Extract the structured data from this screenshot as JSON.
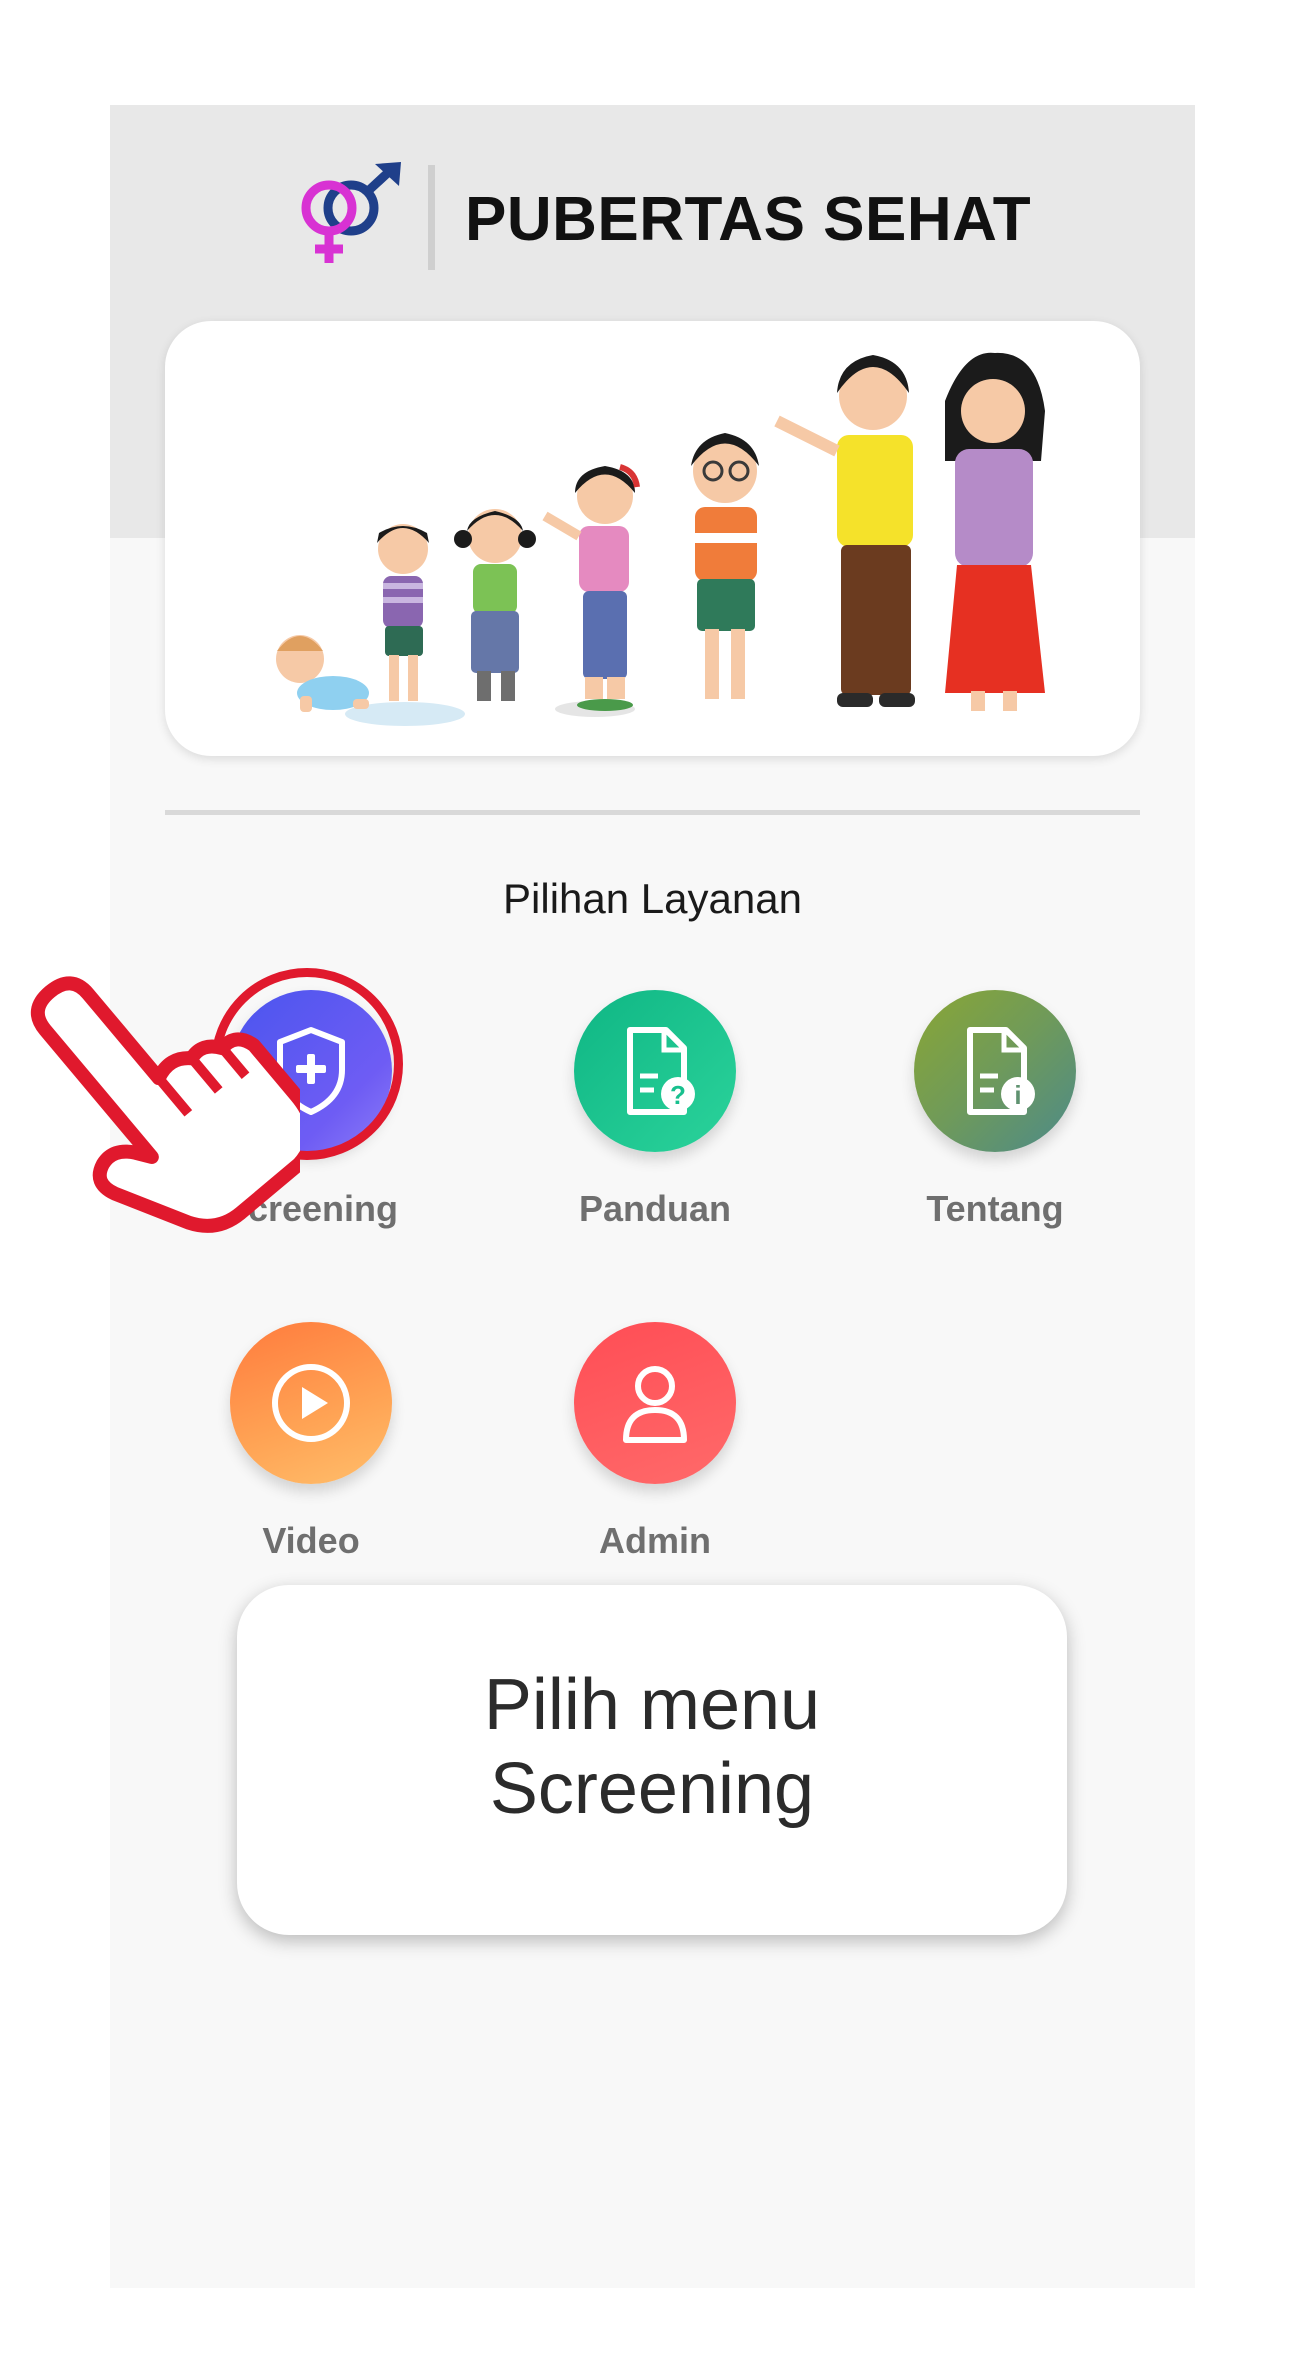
{
  "header": {
    "title": "PUBERTAS SEHAT",
    "logo_icon": "gender-symbols-icon"
  },
  "banner": {
    "image": "growth-stages-illustration"
  },
  "section": {
    "title": "Pilihan Layanan"
  },
  "menu": [
    {
      "id": "screening",
      "label": "Screening",
      "icon": "shield-plus-icon",
      "colors": [
        "#4a55ee",
        "#8c7cf7"
      ]
    },
    {
      "id": "panduan",
      "label": "Panduan",
      "icon": "document-question-icon",
      "colors": [
        "#0fb684",
        "#2bd39b"
      ]
    },
    {
      "id": "tentang",
      "label": "Tentang",
      "icon": "document-info-icon",
      "colors": [
        "#8aa634",
        "#4c8a8a"
      ]
    },
    {
      "id": "video",
      "label": "Video",
      "icon": "play-circle-icon",
      "colors": [
        "#ff7b3d",
        "#ffbe6b"
      ]
    },
    {
      "id": "admin",
      "label": "Admin",
      "icon": "user-icon",
      "colors": [
        "#ff4d55",
        "#ff6a6a"
      ]
    }
  ],
  "tutorial": {
    "line1": "Pilih menu",
    "line2": "Screening",
    "highlight_color": "#e0192d",
    "pointer_icon": "hand-pointer-icon"
  }
}
